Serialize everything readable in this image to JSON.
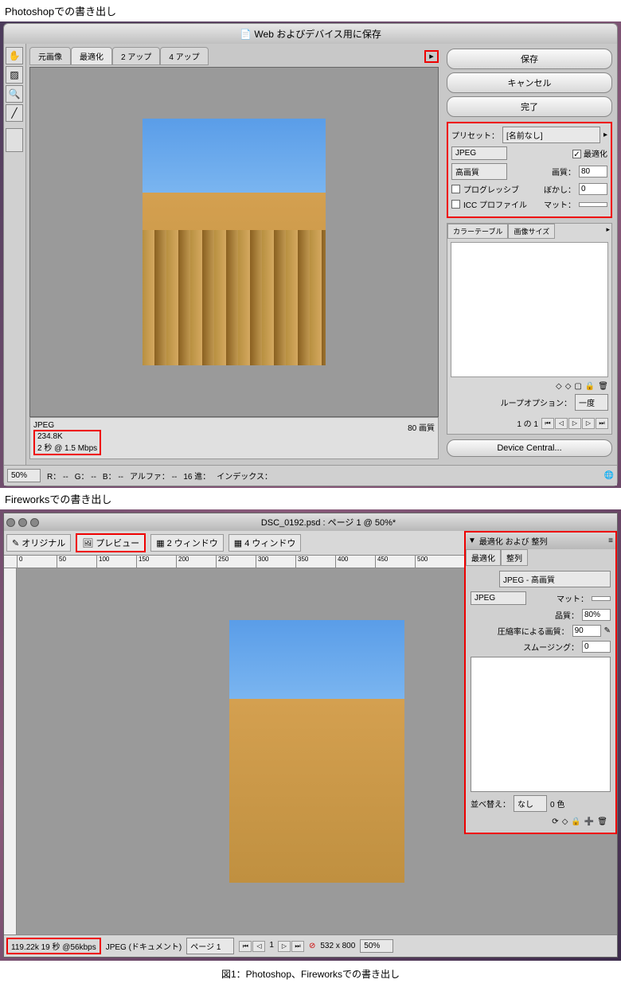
{
  "labels": {
    "ps_section": "Photoshopでの書き出し",
    "fw_section": "Fireworksでの書き出し",
    "caption": "図1：Photoshop、Fireworksでの書き出し"
  },
  "ps": {
    "title": "Web およびデバイス用に保存",
    "tabs": {
      "original": "元画像",
      "optimized": "最適化",
      "twoup": "2 アップ",
      "fourup": "4 アップ"
    },
    "info": {
      "format": "JPEG",
      "size": "234.8K",
      "time": "2 秒 @ 1.5 Mbps",
      "quality_label": "80 画質"
    },
    "buttons": {
      "save": "保存",
      "cancel": "キャンセル",
      "done": "完了",
      "device": "Device Central..."
    },
    "preset": {
      "label": "プリセット：",
      "value": "[名前なし]"
    },
    "format": "JPEG",
    "quality_preset": "高画質",
    "optimize_check": "最適化",
    "quality": {
      "label": "画質：",
      "value": "80"
    },
    "progressive": "プログレッシブ",
    "blur": {
      "label": "ぼかし：",
      "value": "0"
    },
    "icc": "ICC プロファイル",
    "matte": {
      "label": "マット："
    },
    "subtabs": {
      "color": "カラーテーブル",
      "size": "画像サイズ"
    },
    "loop": {
      "label": "ループオプション：",
      "value": "一度"
    },
    "page": "1 の 1",
    "zoom": "50%",
    "rgb": {
      "r": "R：  --",
      "g": "G：  --",
      "b": "B：  --",
      "alpha": "アルファ：  --",
      "hex": "16 進：",
      "index": "インデックス："
    }
  },
  "fw": {
    "title": "DSC_0192.psd : ページ 1 @ 50%*",
    "tabs": {
      "original": "オリジナル",
      "preview": "プレビュー",
      "two": "2 ウィンドウ",
      "four": "4 ウィンドウ"
    },
    "panel": {
      "title": "最適化 および 整列",
      "tab_opt": "最適化",
      "tab_align": "整列",
      "preset": "JPEG - 高画質",
      "format": "JPEG",
      "matte": "マット：",
      "quality": {
        "label": "品質：",
        "value": "80%"
      },
      "selective": {
        "label": "圧縮率による画質：",
        "value": "90"
      },
      "smoothing": {
        "label": "スムージング：",
        "value": "0"
      },
      "sort": {
        "label": "並べ替え：",
        "value": "なし",
        "colors": "0 色"
      }
    },
    "status": {
      "size": "119.22k  19 秒 @56kbps",
      "format": "JPEG (ドキュメント)",
      "page": "ページ 1",
      "dims": "532 x 800",
      "zoom": "50%"
    },
    "ruler": [
      "0",
      "50",
      "100",
      "150",
      "200",
      "250",
      "300",
      "350",
      "400",
      "450",
      "500"
    ]
  }
}
